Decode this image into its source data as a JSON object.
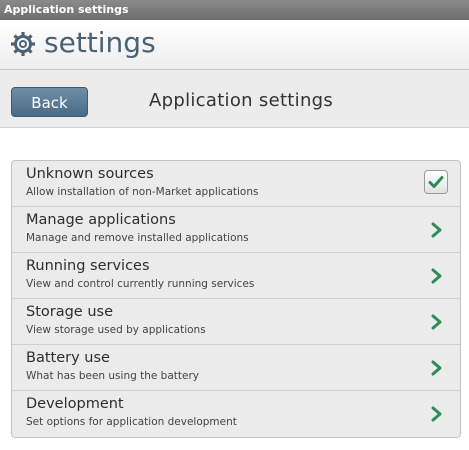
{
  "window": {
    "title": "Application settings"
  },
  "header": {
    "title": "settings",
    "icon": "gear-icon",
    "color": "#4a6275"
  },
  "navbar": {
    "back_label": "Back",
    "page_title": "Application settings"
  },
  "settings": {
    "items": [
      {
        "label": "Unknown sources",
        "description": "Allow installation of non-Market applications",
        "control": "checkbox",
        "checked": true
      },
      {
        "label": "Manage applications",
        "description": "Manage and remove installed applications",
        "control": "chevron-right-icon"
      },
      {
        "label": "Running services",
        "description": "View and control currently running services",
        "control": "chevron-right-icon"
      },
      {
        "label": "Storage use",
        "description": "View storage used by applications",
        "control": "chevron-right-icon"
      },
      {
        "label": "Battery use",
        "description": "What has been using the battery",
        "control": "chevron-right-icon"
      },
      {
        "label": "Development",
        "description": "Set options for application development",
        "control": "chevron-right-icon"
      }
    ]
  },
  "colors": {
    "accent_green": "#2e8b57",
    "back_button": "#5a7a93"
  }
}
